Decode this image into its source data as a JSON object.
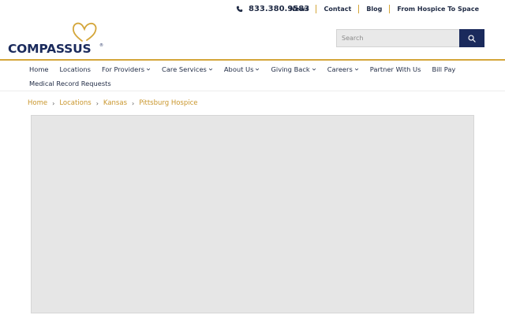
{
  "topbar": {
    "phone": "833.380.9583",
    "links": [
      "News",
      "Contact",
      "Blog",
      "From Hospice To Space"
    ]
  },
  "logo": {
    "wordmark": "COMPASSUS",
    "registered": "®"
  },
  "search": {
    "placeholder": "Search"
  },
  "nav": {
    "items": [
      {
        "label": "Home",
        "dropdown": false
      },
      {
        "label": "Locations",
        "dropdown": false
      },
      {
        "label": "For Providers",
        "dropdown": true
      },
      {
        "label": "Care Services",
        "dropdown": true
      },
      {
        "label": "About Us",
        "dropdown": true
      },
      {
        "label": "Giving Back",
        "dropdown": true
      },
      {
        "label": "Careers",
        "dropdown": true
      },
      {
        "label": "Partner With Us",
        "dropdown": false
      },
      {
        "label": "Bill Pay",
        "dropdown": false
      }
    ],
    "second_row": "Medical Record Requests"
  },
  "breadcrumb": [
    "Home",
    "Locations",
    "Kansas",
    "Pittsburg Hospice"
  ],
  "colors": {
    "navy": "#1a2a5c",
    "gold": "#d4a63a",
    "link_gold": "#c9962c",
    "placeholder_gray": "#e6e6e6"
  }
}
